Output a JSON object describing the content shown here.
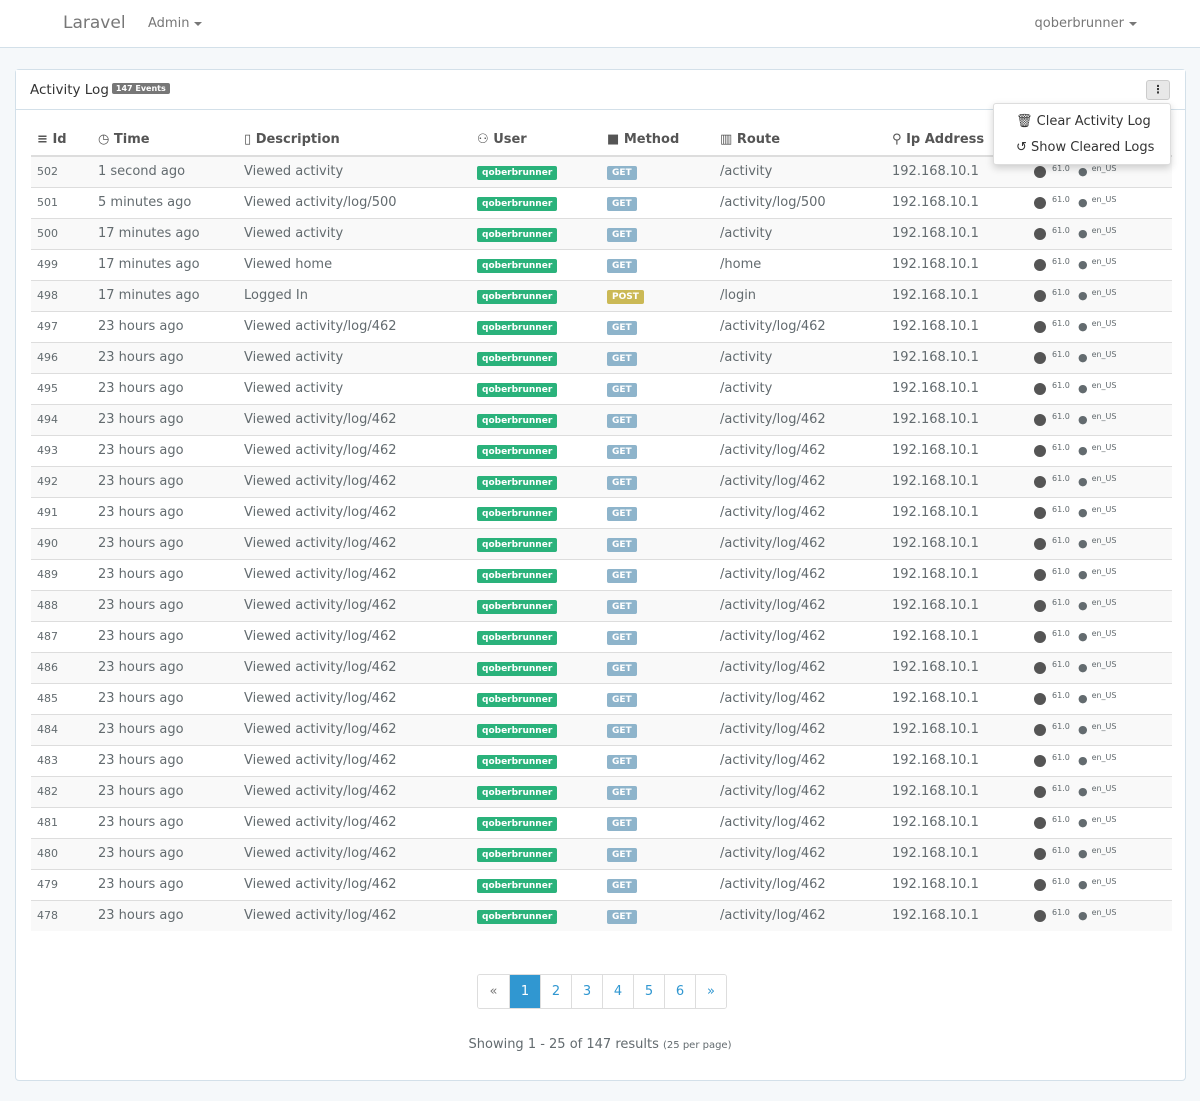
{
  "nav": {
    "brand": "Laravel",
    "admin": "Admin",
    "user": "qoberbrunner"
  },
  "panel": {
    "title": "Activity Log",
    "badge": "147 Events",
    "menu": [
      "Clear Activity Log",
      "Show Cleared Logs"
    ]
  },
  "columns": [
    "Id",
    "Time",
    "Description",
    "User",
    "Method",
    "Route",
    "Ip Address"
  ],
  "colors": {
    "user_badge": "#2ab27b",
    "get": "#8eb4cb",
    "post": "#cbb956",
    "accent": "#3097d1"
  },
  "rows": [
    [
      "502",
      "1 second ago",
      "Viewed activity",
      "qoberbrunner",
      "GET",
      "/activity",
      "192.168.10.1",
      "61.0",
      "en_US"
    ],
    [
      "501",
      "5 minutes ago",
      "Viewed activity/log/500",
      "qoberbrunner",
      "GET",
      "/activity/log/500",
      "192.168.10.1",
      "61.0",
      "en_US"
    ],
    [
      "500",
      "17 minutes ago",
      "Viewed activity",
      "qoberbrunner",
      "GET",
      "/activity",
      "192.168.10.1",
      "61.0",
      "en_US"
    ],
    [
      "499",
      "17 minutes ago",
      "Viewed home",
      "qoberbrunner",
      "GET",
      "/home",
      "192.168.10.1",
      "61.0",
      "en_US"
    ],
    [
      "498",
      "17 minutes ago",
      "Logged In",
      "qoberbrunner",
      "POST",
      "/login",
      "192.168.10.1",
      "61.0",
      "en_US"
    ],
    [
      "497",
      "23 hours ago",
      "Viewed activity/log/462",
      "qoberbrunner",
      "GET",
      "/activity/log/462",
      "192.168.10.1",
      "61.0",
      "en_US"
    ],
    [
      "496",
      "23 hours ago",
      "Viewed activity",
      "qoberbrunner",
      "GET",
      "/activity",
      "192.168.10.1",
      "61.0",
      "en_US"
    ],
    [
      "495",
      "23 hours ago",
      "Viewed activity",
      "qoberbrunner",
      "GET",
      "/activity",
      "192.168.10.1",
      "61.0",
      "en_US"
    ],
    [
      "494",
      "23 hours ago",
      "Viewed activity/log/462",
      "qoberbrunner",
      "GET",
      "/activity/log/462",
      "192.168.10.1",
      "61.0",
      "en_US"
    ],
    [
      "493",
      "23 hours ago",
      "Viewed activity/log/462",
      "qoberbrunner",
      "GET",
      "/activity/log/462",
      "192.168.10.1",
      "61.0",
      "en_US"
    ],
    [
      "492",
      "23 hours ago",
      "Viewed activity/log/462",
      "qoberbrunner",
      "GET",
      "/activity/log/462",
      "192.168.10.1",
      "61.0",
      "en_US"
    ],
    [
      "491",
      "23 hours ago",
      "Viewed activity/log/462",
      "qoberbrunner",
      "GET",
      "/activity/log/462",
      "192.168.10.1",
      "61.0",
      "en_US"
    ],
    [
      "490",
      "23 hours ago",
      "Viewed activity/log/462",
      "qoberbrunner",
      "GET",
      "/activity/log/462",
      "192.168.10.1",
      "61.0",
      "en_US"
    ],
    [
      "489",
      "23 hours ago",
      "Viewed activity/log/462",
      "qoberbrunner",
      "GET",
      "/activity/log/462",
      "192.168.10.1",
      "61.0",
      "en_US"
    ],
    [
      "488",
      "23 hours ago",
      "Viewed activity/log/462",
      "qoberbrunner",
      "GET",
      "/activity/log/462",
      "192.168.10.1",
      "61.0",
      "en_US"
    ],
    [
      "487",
      "23 hours ago",
      "Viewed activity/log/462",
      "qoberbrunner",
      "GET",
      "/activity/log/462",
      "192.168.10.1",
      "61.0",
      "en_US"
    ],
    [
      "486",
      "23 hours ago",
      "Viewed activity/log/462",
      "qoberbrunner",
      "GET",
      "/activity/log/462",
      "192.168.10.1",
      "61.0",
      "en_US"
    ],
    [
      "485",
      "23 hours ago",
      "Viewed activity/log/462",
      "qoberbrunner",
      "GET",
      "/activity/log/462",
      "192.168.10.1",
      "61.0",
      "en_US"
    ],
    [
      "484",
      "23 hours ago",
      "Viewed activity/log/462",
      "qoberbrunner",
      "GET",
      "/activity/log/462",
      "192.168.10.1",
      "61.0",
      "en_US"
    ],
    [
      "483",
      "23 hours ago",
      "Viewed activity/log/462",
      "qoberbrunner",
      "GET",
      "/activity/log/462",
      "192.168.10.1",
      "61.0",
      "en_US"
    ],
    [
      "482",
      "23 hours ago",
      "Viewed activity/log/462",
      "qoberbrunner",
      "GET",
      "/activity/log/462",
      "192.168.10.1",
      "61.0",
      "en_US"
    ],
    [
      "481",
      "23 hours ago",
      "Viewed activity/log/462",
      "qoberbrunner",
      "GET",
      "/activity/log/462",
      "192.168.10.1",
      "61.0",
      "en_US"
    ],
    [
      "480",
      "23 hours ago",
      "Viewed activity/log/462",
      "qoberbrunner",
      "GET",
      "/activity/log/462",
      "192.168.10.1",
      "61.0",
      "en_US"
    ],
    [
      "479",
      "23 hours ago",
      "Viewed activity/log/462",
      "qoberbrunner",
      "GET",
      "/activity/log/462",
      "192.168.10.1",
      "61.0",
      "en_US"
    ],
    [
      "478",
      "23 hours ago",
      "Viewed activity/log/462",
      "qoberbrunner",
      "GET",
      "/activity/log/462",
      "192.168.10.1",
      "61.0",
      "en_US"
    ]
  ],
  "pagination": {
    "prev": "«",
    "pages": [
      "1",
      "2",
      "3",
      "4",
      "5",
      "6"
    ],
    "current": "1",
    "next": "»"
  },
  "footer": {
    "showing": "Showing 1 - 25 of 147 results",
    "per_page": "(25 per page)"
  }
}
